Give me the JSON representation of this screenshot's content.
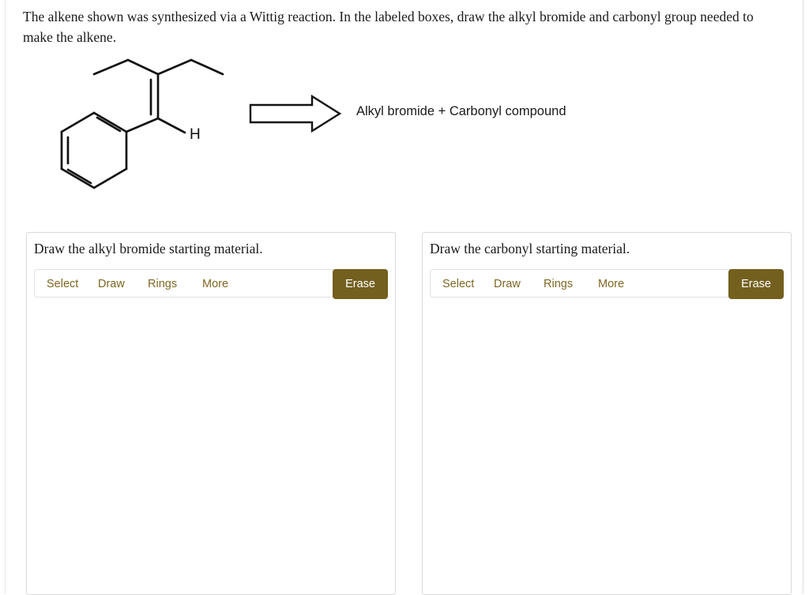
{
  "prompt": {
    "text": "The alkene shown was synthesized via a Wittig reaction. In the labeled boxes, draw the alkyl bromide and carbonyl group needed to make the alkene."
  },
  "reaction": {
    "arrow_icon": "block-arrow-right-icon",
    "products_label": "Alkyl bromide + Carbonyl compound",
    "structure": {
      "name": "alkene-structure",
      "atom_labels": [
        "H"
      ],
      "description": "phenyl-substituted alkene with two ethyl groups"
    }
  },
  "colors": {
    "accent": "#73601f",
    "accent_text": "#7d6723",
    "panel_border": "#d9d9d9",
    "toolbar_border": "#e0e0e0",
    "text": "#1a1a1a",
    "erase_text": "#ffffff"
  },
  "panels": [
    {
      "id": "alkyl-bromide",
      "title": "Draw the alkyl bromide starting material.",
      "tools": [
        {
          "id": "select",
          "label": "Select"
        },
        {
          "id": "draw",
          "label": "Draw"
        },
        {
          "id": "rings",
          "label": "Rings"
        },
        {
          "id": "more",
          "label": "More"
        }
      ],
      "erase_label": "Erase"
    },
    {
      "id": "carbonyl",
      "title": "Draw the carbonyl starting material.",
      "tools": [
        {
          "id": "select",
          "label": "Select"
        },
        {
          "id": "draw",
          "label": "Draw"
        },
        {
          "id": "rings",
          "label": "Rings"
        },
        {
          "id": "more",
          "label": "More"
        }
      ],
      "erase_label": "Erase"
    }
  ]
}
